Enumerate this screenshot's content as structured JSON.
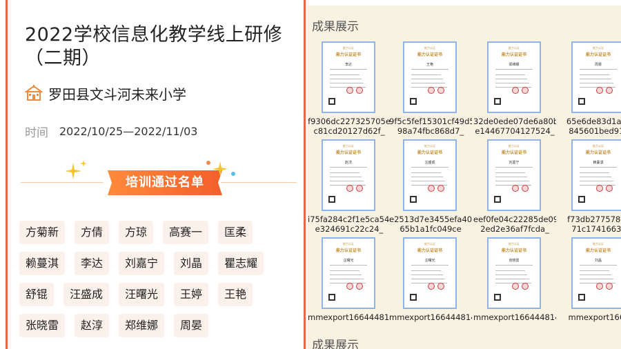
{
  "left": {
    "title": "2022学校信息化教学线上研修（二期）",
    "school": {
      "icon": "school-icon",
      "name": "罗田县文斗河未来小学"
    },
    "time": {
      "label": "时间",
      "value": "2022/10/25—2022/11/03"
    },
    "banner": "培训通过名单",
    "names": [
      [
        "方菊新",
        "方倩",
        "方琼",
        "高赛一",
        "匡柔"
      ],
      [
        "赖蔓淇",
        "李达",
        "刘嘉宁",
        "刘晶",
        "瞿志耀"
      ],
      [
        "舒锟",
        "汪盛成",
        "汪曙光",
        "王婷",
        "王艳"
      ],
      [
        "张晓雷",
        "赵淳",
        "郑维娜",
        "周晏"
      ]
    ]
  },
  "right": {
    "section_title": "成果展示",
    "section_title_2": "成果展示",
    "certificate": {
      "header_small": "能力认证",
      "header": "能力认证证书"
    },
    "rows": [
      [
        {
          "name": "李达",
          "caption": [
            "f9306dc227325705e",
            "c81cd20127d62f_"
          ]
        },
        {
          "name": "王艳",
          "caption": [
            "9f5c5fef15301cf49d5",
            "98a74fbc868d7_"
          ]
        },
        {
          "name": "郑维娜",
          "caption": [
            "32de0ede07de6a80b",
            "e14467704127524_"
          ]
        },
        {
          "name": "周晏",
          "caption": [
            "65e6de83d1a94",
            "845601bed910"
          ]
        }
      ],
      [
        {
          "name": "赵淳",
          "caption": [
            "i75fa284c2f1e5ca54a",
            "e324691c22c24_"
          ]
        },
        {
          "name": "汪盛成",
          "caption": [
            "e2513d7e3455efa408",
            "65b1a1fc049ce"
          ]
        },
        {
          "name": "刘嘉宁",
          "caption": [
            "eef0fe04c22285de09",
            "2ed2e36af7fcda_"
          ]
        },
        {
          "name": "赖蔓淇",
          "caption": [
            "f73db277578d6",
            "71c17416635"
          ]
        }
      ],
      [
        {
          "name": "汪曙光",
          "caption": [
            "mmexport166444814",
            ""
          ]
        },
        {
          "name": "汪曙光",
          "caption": [
            "mmexport166444814",
            ""
          ]
        },
        {
          "name": "张晓雷",
          "caption": [
            "mmexport166444814",
            ""
          ]
        },
        {
          "name": "刘晶",
          "caption": [
            "mmexport1664",
            ""
          ]
        }
      ]
    ]
  }
}
